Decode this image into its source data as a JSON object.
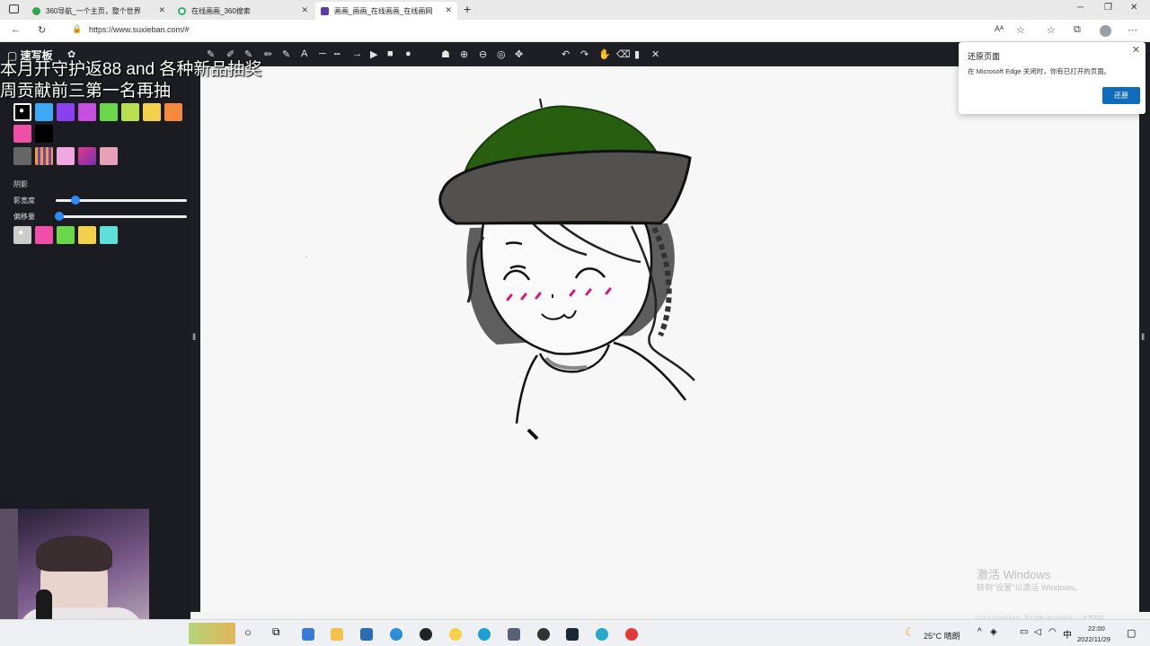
{
  "browser": {
    "tabs": [
      {
        "title": "360导航_一个主页，整个世界",
        "color": "#2fa84f"
      },
      {
        "title": "在线画画_360搜索",
        "color": "#28b463"
      },
      {
        "title": "画画_画画_在线画画_在线画网",
        "color": "#5b3aa4"
      }
    ],
    "new_tab": "+",
    "url": "https://www.suxieban.com/#"
  },
  "app": {
    "logo": "速写板",
    "overlay_line1": "本月开守护返88 and 各种新品抽奖",
    "overlay_line2": "周贡献前三第一名再抽",
    "shadow_label": "阴影",
    "width_label": "影宽度",
    "offset_label": "偏移量",
    "colors_row1": [
      "#ffffff",
      "#3ea8f5",
      "#8a3ff0",
      "#c64fe0",
      "#6ad64a",
      "#b8e04e",
      "#f5d04a",
      "#f58a3f"
    ],
    "colors_row2": [
      "#f04fa8",
      "#000000"
    ],
    "shadow_colors": [
      "#cccccc",
      "#f04fa8",
      "#6ad64a",
      "#f5d04a",
      "#5ee0d8"
    ],
    "shadow_width": 0.15,
    "shadow_offset": 0.03
  },
  "popup": {
    "title": "还原页面",
    "message": "在 Microsoft Edge 关闭时，你有已打开的页面。",
    "button": "还原",
    "close": "✕"
  },
  "watermark": {
    "line1": "激活 Windows",
    "line2": "转到\"设置\"以激活 Windows。"
  },
  "footer": "©2019 SUXIEBAN | 浙ICP备19019999号-1 | 免责声明",
  "taskbar": {
    "weather": "25°C 晴朗",
    "ime": "中",
    "time": "22:00",
    "date": "2022/11/29"
  }
}
